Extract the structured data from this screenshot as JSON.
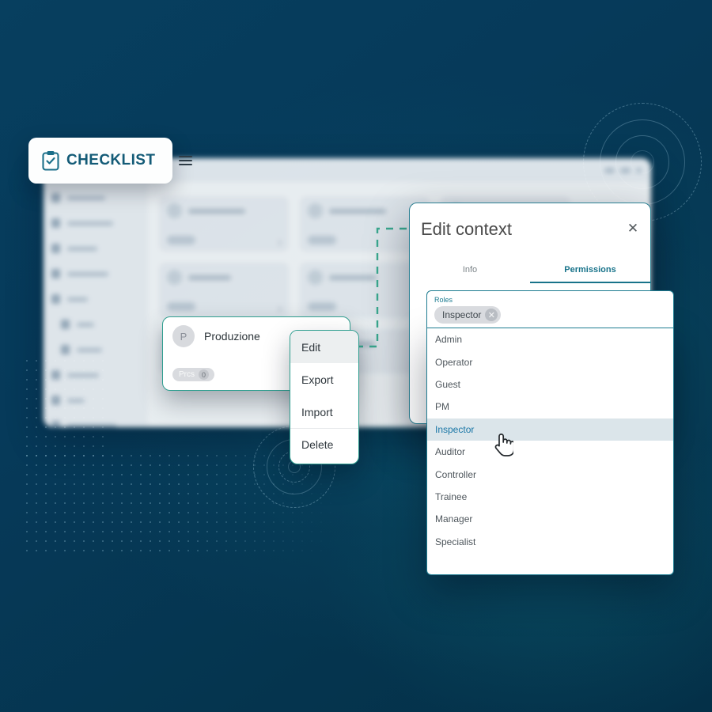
{
  "brand": {
    "name": "CHECKLIST",
    "logo_icon": "clipboard-check-icon",
    "menu_icon": "hamburger-menu-icon",
    "accent_color": "#135b77"
  },
  "theme": {
    "background_color": "#063a5a",
    "teal_accent": "#2e9e8f",
    "modal_border": "#1d7c91",
    "selected_option_color": "#1976a6"
  },
  "card": {
    "avatar_initial": "P",
    "title": "Produzione",
    "badge_label": "Prcs",
    "badge_count": "0"
  },
  "context_menu": {
    "items": [
      {
        "label": "Edit",
        "active": true
      },
      {
        "label": "Export",
        "active": false
      },
      {
        "label": "Import",
        "active": false
      },
      {
        "label": "Delete",
        "active": false
      }
    ]
  },
  "modal": {
    "title": "Edit context",
    "close_icon": "close-icon",
    "tabs": [
      {
        "label": "Info",
        "active": false
      },
      {
        "label": "Permissions",
        "active": true
      }
    ]
  },
  "roles_field": {
    "label": "Roles",
    "selected_chips": [
      {
        "label": "Inspector",
        "remove_icon": "chip-remove-icon"
      }
    ]
  },
  "roles_dropdown": {
    "options": [
      {
        "label": "Admin",
        "selected": false
      },
      {
        "label": "Operator",
        "selected": false
      },
      {
        "label": "Guest",
        "selected": false
      },
      {
        "label": "PM",
        "selected": false
      },
      {
        "label": "Inspector",
        "selected": true
      },
      {
        "label": "Auditor",
        "selected": false
      },
      {
        "label": "Controller",
        "selected": false
      },
      {
        "label": "Trainee",
        "selected": false
      },
      {
        "label": "Manager",
        "selected": false
      },
      {
        "label": "Specialist",
        "selected": false
      }
    ]
  },
  "cursor": {
    "type": "pointing-hand-cursor"
  }
}
